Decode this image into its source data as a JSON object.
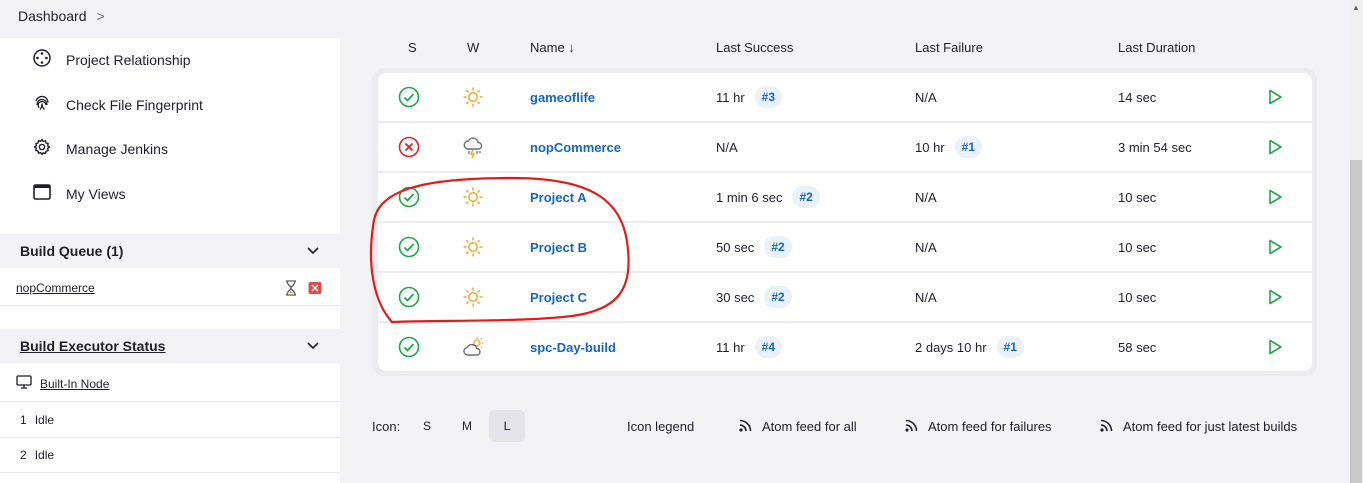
{
  "breadcrumb": {
    "root": "Dashboard",
    "chevron": ">"
  },
  "sidebar": {
    "items": [
      {
        "label": "Project Relationship",
        "icon": "project-relationship-icon"
      },
      {
        "label": "Check File Fingerprint",
        "icon": "fingerprint-icon"
      },
      {
        "label": "Manage Jenkins",
        "icon": "gear-icon"
      },
      {
        "label": "My Views",
        "icon": "window-icon"
      }
    ],
    "build_queue": {
      "title": "Build Queue (1)",
      "items": [
        {
          "label": "nopCommerce"
        }
      ]
    },
    "executor_status": {
      "title": "Build Executor Status",
      "node": "Built-In Node",
      "executors": [
        {
          "num": "1",
          "state": "Idle"
        },
        {
          "num": "2",
          "state": "Idle"
        }
      ]
    }
  },
  "table": {
    "headers": {
      "s": "S",
      "w": "W",
      "name": "Name ↓",
      "last_success": "Last Success",
      "last_failure": "Last Failure",
      "last_duration": "Last Duration"
    },
    "rows": [
      {
        "status": "success",
        "weather": "sunny",
        "name": "gameoflife",
        "last_success": "11 hr",
        "success_build": "#3",
        "last_failure": "N/A",
        "failure_build": "",
        "duration": "14 sec"
      },
      {
        "status": "failed",
        "weather": "storm",
        "name": "nopCommerce",
        "last_success": "N/A",
        "success_build": "",
        "last_failure": "10 hr",
        "failure_build": "#1",
        "duration": "3 min 54 sec"
      },
      {
        "status": "success",
        "weather": "sunny",
        "name": "Project A",
        "last_success": "1 min 6 sec",
        "success_build": "#2",
        "last_failure": "N/A",
        "failure_build": "",
        "duration": "10 sec"
      },
      {
        "status": "success",
        "weather": "sunny",
        "name": "Project B",
        "last_success": "50 sec",
        "success_build": "#2",
        "last_failure": "N/A",
        "failure_build": "",
        "duration": "10 sec"
      },
      {
        "status": "success",
        "weather": "sunny",
        "name": "Project C",
        "last_success": "30 sec",
        "success_build": "#2",
        "last_failure": "N/A",
        "failure_build": "",
        "duration": "10 sec"
      },
      {
        "status": "success",
        "weather": "partly-cloudy",
        "name": "spc-Day-build",
        "last_success": "11 hr",
        "success_build": "#4",
        "last_failure": "2 days 10 hr",
        "failure_build": "#1",
        "duration": "58 sec"
      }
    ]
  },
  "footer": {
    "icon_label": "Icon:",
    "sizes": [
      "S",
      "M",
      "L"
    ],
    "selected_size": "L",
    "legend": "Icon legend",
    "feeds": [
      "Atom feed for all",
      "Atom feed for failures",
      "Atom feed for just latest builds"
    ]
  },
  "colors": {
    "success": "#1ea64b",
    "failure": "#d6262b",
    "link": "#1466c4",
    "sun": "#f0a92b",
    "annotation": "#e21b1b"
  }
}
